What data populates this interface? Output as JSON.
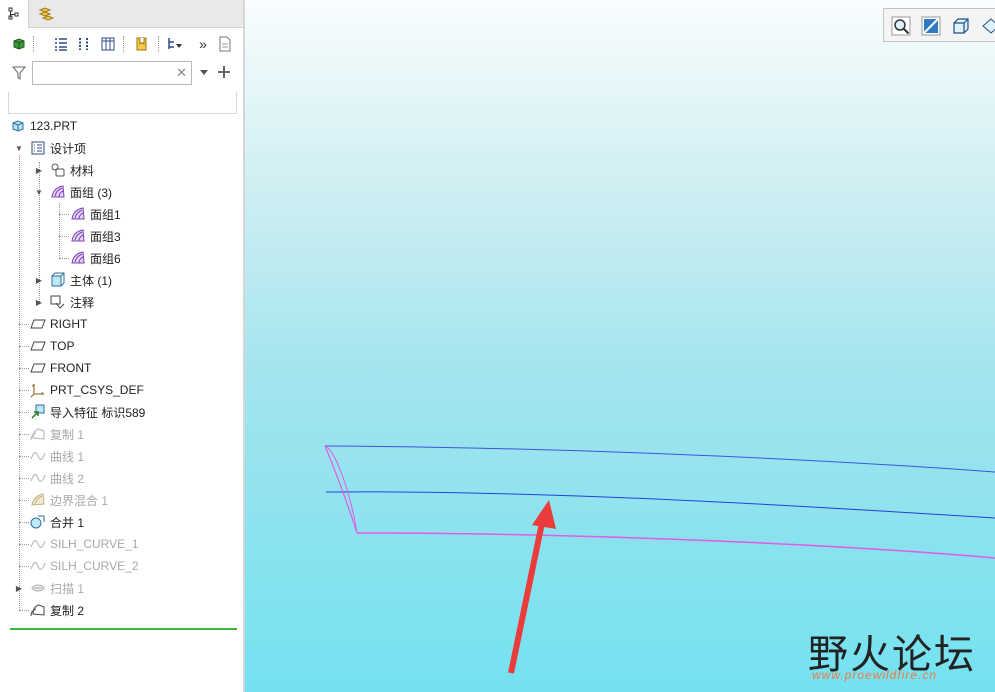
{
  "tree": {
    "root": "123.PRT",
    "items": [
      {
        "label": "设计项",
        "icon": "design-items-icon"
      },
      {
        "label": "材料",
        "icon": "materials-icon"
      },
      {
        "label": "面组 (3)",
        "icon": "quilt-icon"
      },
      {
        "label": "面组1",
        "icon": "quilt-icon"
      },
      {
        "label": "面组3",
        "icon": "quilt-icon"
      },
      {
        "label": "面组6",
        "icon": "quilt-icon"
      },
      {
        "label": "主体 (1)",
        "icon": "body-icon"
      },
      {
        "label": "注释",
        "icon": "annotation-icon"
      },
      {
        "label": "RIGHT",
        "icon": "datum-plane-icon"
      },
      {
        "label": "TOP",
        "icon": "datum-plane-icon"
      },
      {
        "label": "FRONT",
        "icon": "datum-plane-icon"
      },
      {
        "label": "PRT_CSYS_DEF",
        "icon": "csys-icon"
      },
      {
        "label": "导入特征 标识589",
        "icon": "import-feature-icon"
      },
      {
        "label": "复制 1",
        "icon": "copy-icon"
      },
      {
        "label": "曲线 1",
        "icon": "curve-icon"
      },
      {
        "label": "曲线 2",
        "icon": "curve-icon"
      },
      {
        "label": "边界混合 1",
        "icon": "boundary-blend-icon"
      },
      {
        "label": "合并 1",
        "icon": "merge-icon"
      },
      {
        "label": "SILH_CURVE_1",
        "icon": "curve-icon"
      },
      {
        "label": "SILH_CURVE_2",
        "icon": "curve-icon"
      },
      {
        "label": "扫描 1",
        "icon": "sweep-icon"
      },
      {
        "label": "复制 2",
        "icon": "copy-icon"
      }
    ]
  },
  "filter": {
    "placeholder": "",
    "value": ""
  },
  "watermark": {
    "brand": "野火论坛",
    "url": "www.proewildfire.cn"
  },
  "colors": {
    "viewport_top": "#fafdfe",
    "viewport_bottom": "#74e1f0",
    "curve_blue": "#3b56d8",
    "curve_magenta": "#e05ce6",
    "arrow_red": "#ec3b3b",
    "insert_bar": "#3db83d"
  }
}
